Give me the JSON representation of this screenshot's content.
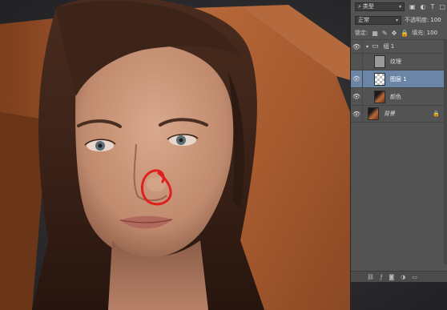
{
  "layers_panel": {
    "filter": {
      "label": "类型",
      "icons": [
        "image-filter-icon",
        "adjustment-filter-icon",
        "text-filter-icon",
        "shape-filter-icon",
        "smart-object-filter-icon"
      ]
    },
    "blend_mode": "正常",
    "opacity": {
      "label": "不透明度:",
      "value": "100"
    },
    "lock": {
      "label": "锁定:",
      "icons": [
        "lock-transparent-icon",
        "lock-paint-icon",
        "lock-move-icon",
        "lock-all-icon"
      ]
    },
    "fill": {
      "label": "填充:",
      "value": "100"
    },
    "layers": [
      {
        "name": "组 1",
        "type": "group",
        "visible": true,
        "expanded": true
      },
      {
        "name": "纹理",
        "type": "layer",
        "visible": false,
        "thumb": "gray"
      },
      {
        "name": "图层 1",
        "type": "layer",
        "visible": true,
        "selected": true,
        "thumb": "transparent"
      },
      {
        "name": "颜色",
        "type": "layer",
        "visible": true,
        "thumb": "photo"
      },
      {
        "name": "背景",
        "type": "background",
        "visible": true,
        "locked": true,
        "thumb": "photo"
      }
    ],
    "colors": {
      "panel_bg": "#535353",
      "selected_row": "#6a85a6",
      "annotation": "#e01f1f"
    }
  }
}
